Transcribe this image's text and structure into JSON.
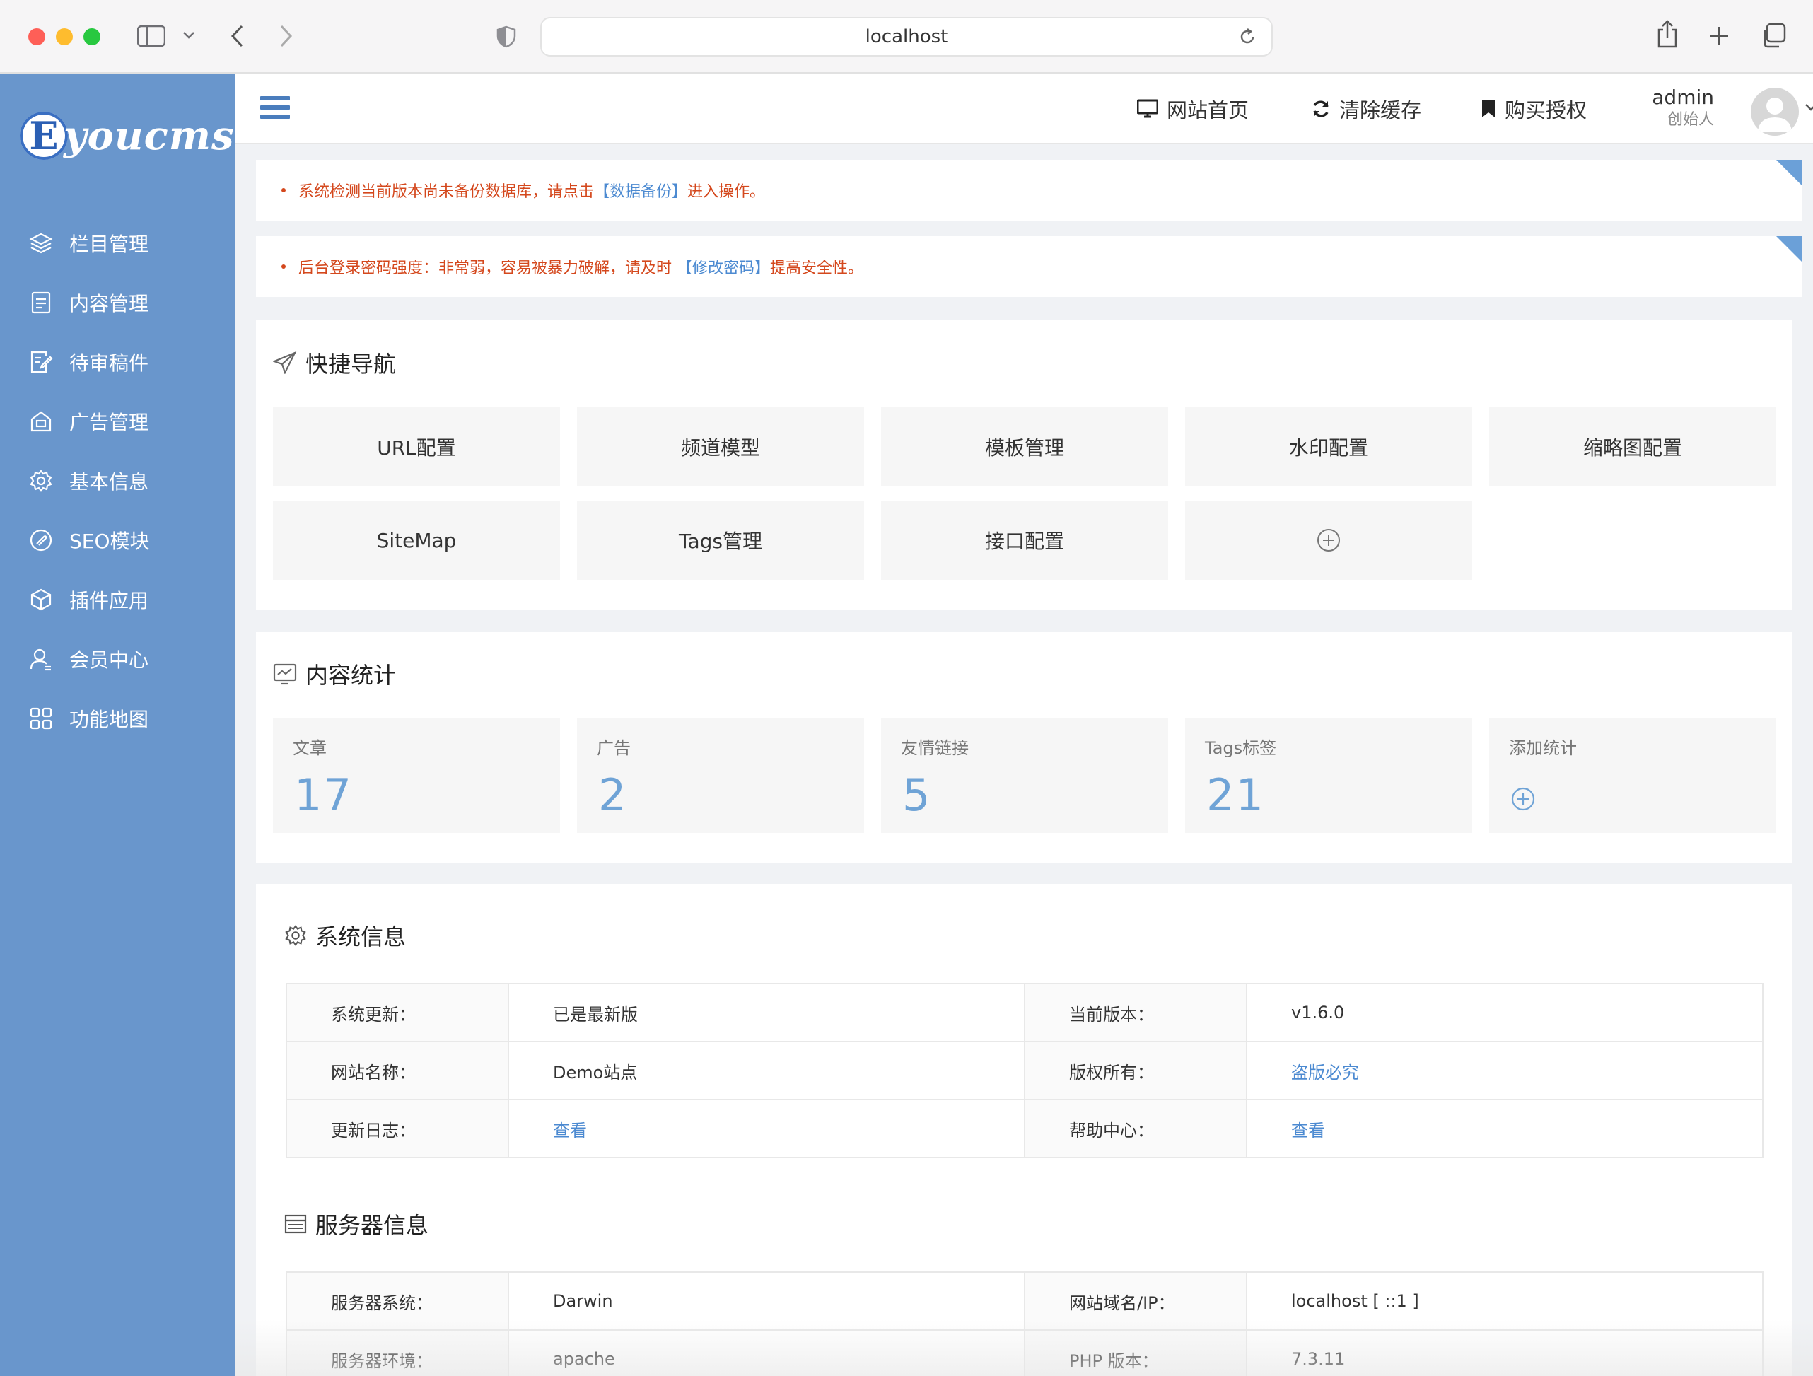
{
  "browser": {
    "url": "localhost"
  },
  "sidebar": {
    "logo_letter": "E",
    "logo_text": "youcms",
    "items": [
      {
        "label": "栏目管理",
        "icon": "layers-icon"
      },
      {
        "label": "内容管理",
        "icon": "document-icon"
      },
      {
        "label": "待审稿件",
        "icon": "edit-document-icon"
      },
      {
        "label": "广告管理",
        "icon": "ad-icon"
      },
      {
        "label": "基本信息",
        "icon": "gear-icon"
      },
      {
        "label": "SEO模块",
        "icon": "seo-icon"
      },
      {
        "label": "插件应用",
        "icon": "plugin-icon"
      },
      {
        "label": "会员中心",
        "icon": "user-icon"
      },
      {
        "label": "功能地图",
        "icon": "grid-icon"
      }
    ]
  },
  "header": {
    "home_label": "网站首页",
    "clear_cache_label": "清除缓存",
    "buy_license_label": "购买授权",
    "user_name": "admin",
    "user_role": "创始人"
  },
  "notices": [
    {
      "before": "系统检测当前版本尚未备份数据库，请点击",
      "link": "【数据备份】",
      "after": "进入操作。"
    },
    {
      "before": "后台登录密码强度：非常弱，容易被暴力破解，请及时 ",
      "link": "【修改密码】",
      "after": "提高安全性。"
    }
  ],
  "quick_nav": {
    "title": "快捷导航",
    "items": [
      "URL配置",
      "频道模型",
      "模板管理",
      "水印配置",
      "缩略图配置",
      "SiteMap",
      "Tags管理",
      "接口配置"
    ]
  },
  "stats": {
    "title": "内容统计",
    "items": [
      {
        "label": "文章",
        "value": "17"
      },
      {
        "label": "广告",
        "value": "2"
      },
      {
        "label": "友情链接",
        "value": "5"
      },
      {
        "label": "Tags标签",
        "value": "21"
      }
    ],
    "add_label": "添加统计"
  },
  "system_info": {
    "title": "系统信息",
    "rows": [
      [
        "系统更新：",
        "已是最新版",
        "当前版本：",
        "v1.6.0"
      ],
      [
        "网站名称：",
        "Demo站点",
        "版权所有：",
        "盗版必究"
      ],
      [
        "更新日志：",
        "查看",
        "帮助中心：",
        "查看"
      ]
    ]
  },
  "server_info": {
    "title": "服务器信息",
    "rows": [
      [
        "服务器系统：",
        "Darwin",
        "网站域名/IP：",
        "localhost [ ::1 ]"
      ],
      [
        "服务器环境：",
        "apache",
        "PHP 版本：",
        "7.3.11"
      ]
    ]
  },
  "colors": {
    "sidebar": "#6996cc",
    "accent": "#4c8ad1",
    "notice": "#d4481d",
    "stat_value": "#6fa3d6"
  }
}
